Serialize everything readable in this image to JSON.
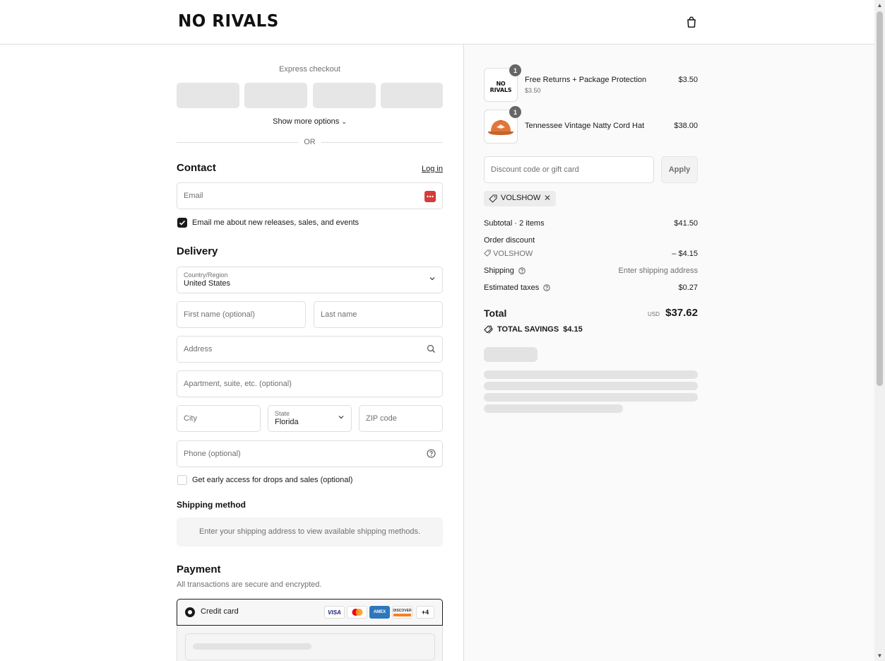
{
  "header": {
    "logo": "NO RIVALS",
    "cart_icon": "shopping-bag-icon"
  },
  "express": {
    "title": "Express checkout",
    "show_more": "Show more options",
    "or": "OR"
  },
  "contact": {
    "heading": "Contact",
    "login": "Log in",
    "email_placeholder": "Email",
    "newsletter_label": "Email me about new releases, sales, and events",
    "newsletter_checked": true
  },
  "delivery": {
    "heading": "Delivery",
    "country_label": "Country/Region",
    "country_value": "United States",
    "first_name_placeholder": "First name (optional)",
    "last_name_placeholder": "Last name",
    "address_placeholder": "Address",
    "apartment_placeholder": "Apartment, suite, etc. (optional)",
    "city_placeholder": "City",
    "state_label": "State",
    "state_value": "Florida",
    "zip_placeholder": "ZIP code",
    "phone_placeholder": "Phone (optional)",
    "early_access_label": "Get early access for drops and sales (optional)",
    "early_access_checked": false
  },
  "shipping_method": {
    "heading": "Shipping method",
    "message": "Enter your shipping address to view available shipping methods."
  },
  "payment": {
    "heading": "Payment",
    "subtitle": "All transactions are secure and encrypted.",
    "method_label": "Credit card",
    "cards": [
      "VISA",
      "mastercard",
      "AMEX",
      "DISCOVER"
    ],
    "more_cards": "+4"
  },
  "order": {
    "items": [
      {
        "name": "Free Returns + Package Protection",
        "sub": "$3.50",
        "price": "$3.50",
        "qty": "1",
        "thumb_text": "NO RIVALS"
      },
      {
        "name": "Tennessee Vintage Natty Cord Hat",
        "sub": "",
        "price": "$38.00",
        "qty": "1",
        "thumb_text": ""
      }
    ],
    "discount_placeholder": "Discount code or gift card",
    "apply": "Apply",
    "applied_code": "VOLSHOW",
    "subtotal_label": "Subtotal · 2 items",
    "subtotal_value": "$41.50",
    "order_discount_label": "Order discount",
    "discount_code": "VOLSHOW",
    "discount_value": "– $4.15",
    "shipping_label": "Shipping",
    "shipping_value": "Enter shipping address",
    "taxes_label": "Estimated taxes",
    "taxes_value": "$0.27",
    "total_label": "Total",
    "currency": "USD",
    "total_value": "$37.62",
    "savings_label": "TOTAL SAVINGS",
    "savings_value": "$4.15"
  }
}
